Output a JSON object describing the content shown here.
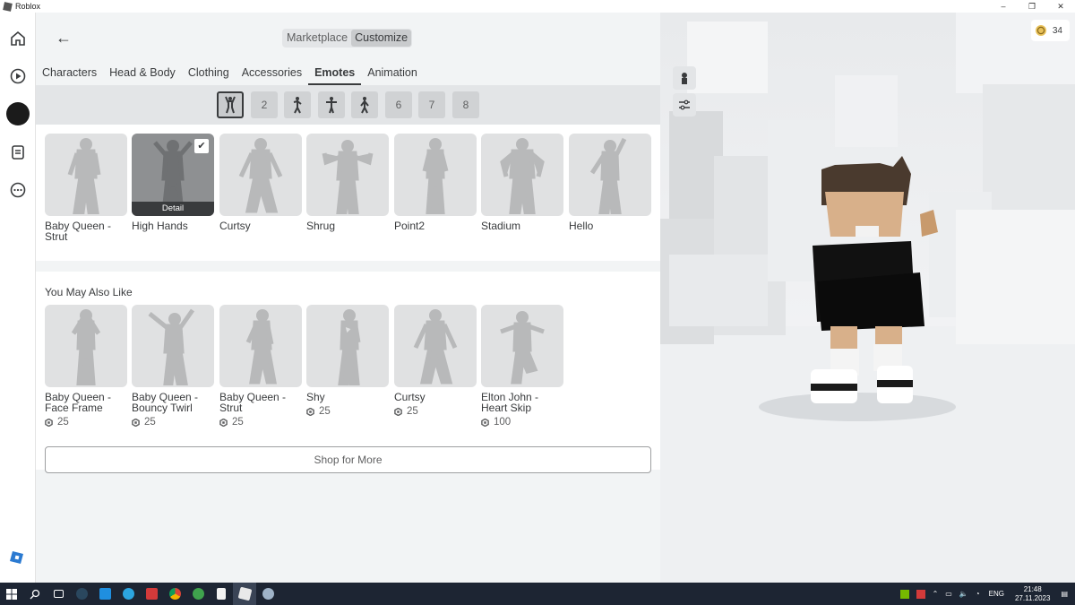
{
  "window": {
    "title": "Roblox",
    "controls": [
      "–",
      "❐",
      "✕"
    ]
  },
  "topbar": {
    "segments": [
      "Marketplace",
      "Customize"
    ],
    "active_segment": "Customize"
  },
  "tabs": [
    "Characters",
    "Head & Body",
    "Clothing",
    "Accessories",
    "Emotes",
    "Animation"
  ],
  "active_tab": "Emotes",
  "emote_slots": [
    "",
    "2",
    "",
    "",
    "",
    "6",
    "7",
    "8"
  ],
  "owned_emotes": [
    {
      "name": "Baby Queen - Strut"
    },
    {
      "name": "High Hands",
      "selected": true,
      "overlay": "Detail"
    },
    {
      "name": "Curtsy"
    },
    {
      "name": "Shrug"
    },
    {
      "name": "Point2"
    },
    {
      "name": "Stadium"
    },
    {
      "name": "Hello"
    }
  ],
  "recommended": {
    "title": "You May Also Like",
    "items": [
      {
        "name": "Baby Queen - Face Frame",
        "price": "25"
      },
      {
        "name": "Baby Queen - Bouncy Twirl",
        "price": "25"
      },
      {
        "name": "Baby Queen - Strut",
        "price": "25"
      },
      {
        "name": "Shy",
        "price": "25"
      },
      {
        "name": "Curtsy",
        "price": "25"
      },
      {
        "name": "Elton John - Heart Skip",
        "price": "100"
      }
    ],
    "shop_button": "Shop for More"
  },
  "balance": {
    "robux": "34"
  },
  "taskbar": {
    "lang": "ENG",
    "time": "21:48",
    "date": "27.11.2023"
  },
  "colors": {
    "panel": "#f2f4f5",
    "card": "#e0e1e2",
    "text": "#393b3d",
    "taskbar": "#1d2533"
  }
}
